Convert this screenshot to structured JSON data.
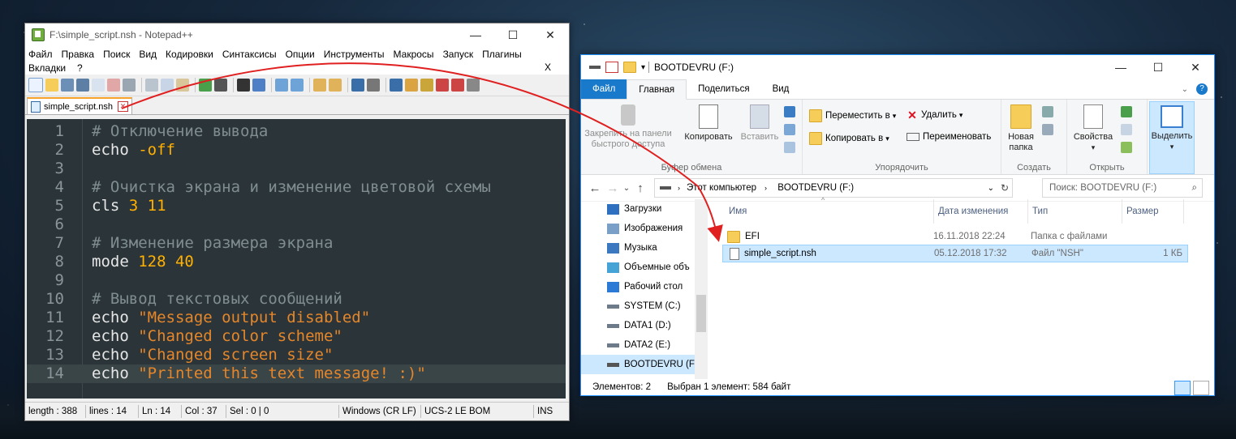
{
  "npp": {
    "title": "F:\\simple_script.nsh - Notepad++",
    "menu": [
      "Файл",
      "Правка",
      "Поиск",
      "Вид",
      "Кодировки",
      "Синтаксисы",
      "Опции",
      "Инструменты",
      "Макросы",
      "Запуск",
      "Плагины"
    ],
    "menu2": [
      "Вкладки",
      "?"
    ],
    "menu_close": "X",
    "tab_label": "simple_script.nsh",
    "lines": [
      {
        "n": "1",
        "tokens": [
          {
            "t": "# Отключение вывода",
            "c": "comment"
          }
        ]
      },
      {
        "n": "2",
        "tokens": [
          {
            "t": "echo ",
            "c": ""
          },
          {
            "t": "-off",
            "c": "num"
          }
        ]
      },
      {
        "n": "3",
        "tokens": []
      },
      {
        "n": "4",
        "tokens": [
          {
            "t": "# Очистка экрана и изменение цветовой схемы",
            "c": "comment"
          }
        ]
      },
      {
        "n": "5",
        "tokens": [
          {
            "t": "cls ",
            "c": ""
          },
          {
            "t": "3 11",
            "c": "num"
          }
        ]
      },
      {
        "n": "6",
        "tokens": []
      },
      {
        "n": "7",
        "tokens": [
          {
            "t": "# Изменение размера экрана",
            "c": "comment"
          }
        ]
      },
      {
        "n": "8",
        "tokens": [
          {
            "t": "mode ",
            "c": ""
          },
          {
            "t": "128 40",
            "c": "num"
          }
        ]
      },
      {
        "n": "9",
        "tokens": []
      },
      {
        "n": "10",
        "tokens": [
          {
            "t": "# Вывод текстовых сообщений",
            "c": "comment"
          }
        ]
      },
      {
        "n": "11",
        "tokens": [
          {
            "t": "echo ",
            "c": ""
          },
          {
            "t": "\"Message output disabled\"",
            "c": "str"
          }
        ]
      },
      {
        "n": "12",
        "tokens": [
          {
            "t": "echo ",
            "c": ""
          },
          {
            "t": "\"Changed color scheme\"",
            "c": "str"
          }
        ]
      },
      {
        "n": "13",
        "tokens": [
          {
            "t": "echo ",
            "c": ""
          },
          {
            "t": "\"Changed screen size\"",
            "c": "str"
          }
        ]
      },
      {
        "n": "14",
        "tokens": [
          {
            "t": "echo ",
            "c": ""
          },
          {
            "t": "\"Printed this text message! :)\"",
            "c": "str"
          }
        ]
      }
    ],
    "current_line": 14,
    "status": {
      "length": "length : 388",
      "lines": "lines : 14",
      "ln": "Ln : 14",
      "col": "Col : 37",
      "sel": "Sel : 0 | 0",
      "eol": "Windows (CR LF)",
      "encoding": "UCS-2 LE BOM",
      "mode": "INS"
    }
  },
  "explorer": {
    "title": "BOOTDEVRU (F:)",
    "tabs": [
      "Файл",
      "Главная",
      "Поделиться",
      "Вид"
    ],
    "ribbon": {
      "pin": "Закрепить на панели быстрого доступа",
      "copy": "Копировать",
      "paste": "Вставить",
      "clipboard_group": "Буфер обмена",
      "move_to": "Переместить в",
      "copy_to": "Копировать в",
      "delete": "Удалить",
      "rename": "Переименовать",
      "organize_group": "Упорядочить",
      "new_folder": "Новая папка",
      "create_group": "Создать",
      "properties": "Свойства",
      "open_group": "Открыть",
      "select": "Выделить"
    },
    "address": [
      "Этот компьютер",
      "BOOTDEVRU (F:)"
    ],
    "search_placeholder": "Поиск: BOOTDEVRU (F:)",
    "nav": [
      {
        "label": "Загрузки",
        "icon": "download-icon"
      },
      {
        "label": "Изображения",
        "icon": "pictures-icon"
      },
      {
        "label": "Музыка",
        "icon": "music-icon"
      },
      {
        "label": "Объемные объ",
        "icon": "3d-objects-icon"
      },
      {
        "label": "Рабочий стол",
        "icon": "desktop-icon"
      },
      {
        "label": "SYSTEM (C:)",
        "icon": "system-drive-icon"
      },
      {
        "label": "DATA1 (D:)",
        "icon": "drive-icon"
      },
      {
        "label": "DATA2 (E:)",
        "icon": "drive-icon"
      },
      {
        "label": "BOOTDEVRU (F:)",
        "icon": "usb-drive-icon"
      }
    ],
    "columns": [
      "Имя",
      "Дата изменения",
      "Тип",
      "Размер"
    ],
    "files": [
      {
        "name": "EFI",
        "date": "16.11.2018 22:24",
        "type": "Папка с файлами",
        "size": "",
        "icon": "folder-icon"
      },
      {
        "name": "simple_script.nsh",
        "date": "05.12.2018 17:32",
        "type": "Файл \"NSH\"",
        "size": "1 КБ",
        "icon": "file-icon"
      }
    ],
    "status_items": "Элементов: 2",
    "status_selected": "Выбран 1 элемент: 584 байт"
  },
  "colors": {
    "arrow": "#e02020",
    "explorer_accent": "#1979ca",
    "npp_bg": "#2b3539"
  }
}
